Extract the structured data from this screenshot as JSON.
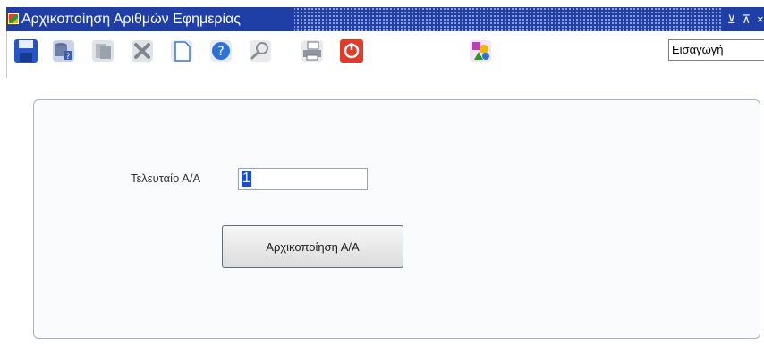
{
  "window": {
    "title": "Αρχικοποίηση Αριθμών Εφημερίας",
    "minimize_glyph": "⊻",
    "maximize_glyph": "⊼",
    "close_glyph": "×"
  },
  "toolbar": {
    "buttons": [
      {
        "name": "save-icon",
        "color": "#2456c8"
      },
      {
        "name": "database-help-icon",
        "color": "#7a8bb0"
      },
      {
        "name": "document-list-icon",
        "color": "#9aa2ac"
      },
      {
        "name": "delete-icon",
        "color": "#7f868e"
      },
      {
        "name": "new-document-icon",
        "color": "#3a78d8"
      },
      {
        "name": "help-icon",
        "color": "#2f6fd8"
      },
      {
        "name": "zoom-icon",
        "color": "#8a8f96"
      },
      {
        "name": "print-icon",
        "color": "#6f7680"
      },
      {
        "name": "exit-icon",
        "color": "#e23b2a"
      },
      {
        "name": "shapes-icon",
        "color": "#c03ac0"
      }
    ],
    "mode_value": "Εισαγωγή"
  },
  "form": {
    "field_label": "Τελευταίο Α/Α",
    "field_value": "1",
    "action_button_label": "Αρχικοποίηση Α/Α"
  }
}
